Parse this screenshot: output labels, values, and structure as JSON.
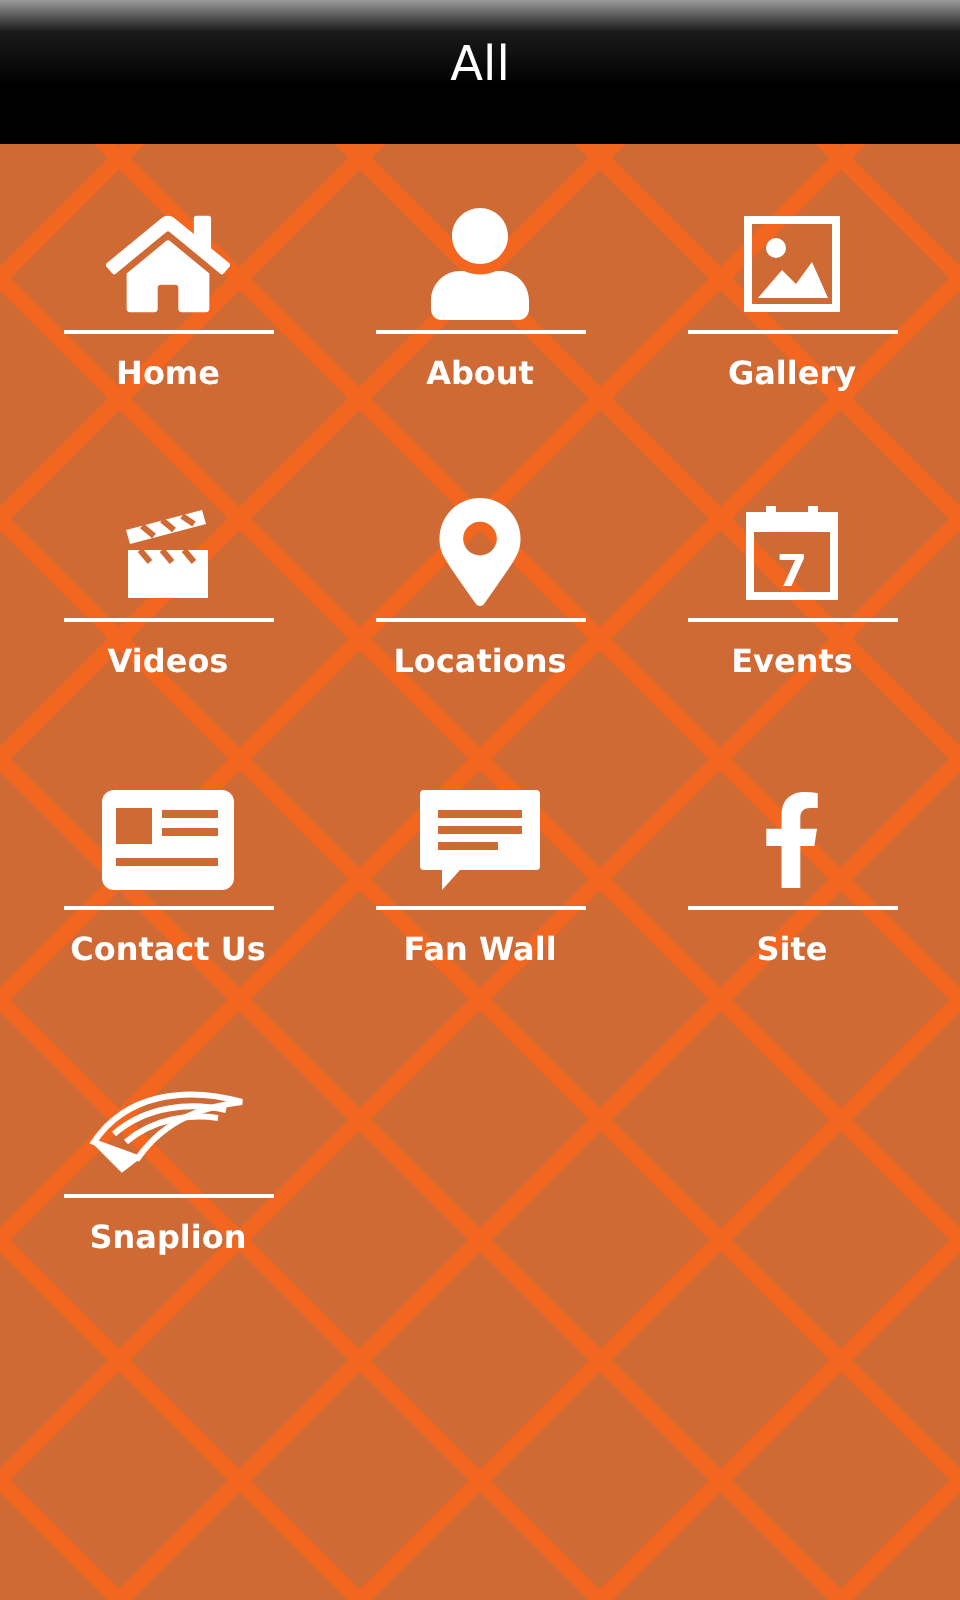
{
  "header": {
    "title": "All"
  },
  "menu": [
    {
      "label": "Home",
      "kind": "home"
    },
    {
      "label": "About",
      "kind": "person"
    },
    {
      "label": "Gallery",
      "kind": "image"
    },
    {
      "label": "Videos",
      "kind": "clapper"
    },
    {
      "label": "Locations",
      "kind": "pin"
    },
    {
      "label": "Events",
      "kind": "calendar",
      "icon_text": "7"
    },
    {
      "label": "Contact Us",
      "kind": "card"
    },
    {
      "label": "Fan Wall",
      "kind": "message"
    },
    {
      "label": "Site",
      "kind": "facebook"
    },
    {
      "label": "Snaplion",
      "kind": "snaplion"
    }
  ]
}
